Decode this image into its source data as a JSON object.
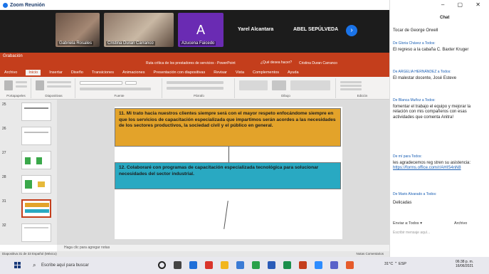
{
  "window": {
    "title": "Zoom Reunión"
  },
  "video": {
    "tiles": [
      {
        "name": "Gabriela Rosales"
      },
      {
        "name": "Cristina Duran Carranco"
      },
      {
        "name": "Azucena Faicedo",
        "initial": "A"
      }
    ],
    "labels": [
      "Yarel Alcantara",
      "ABEL SEPÚLVEDA"
    ],
    "next_glyph": "›"
  },
  "ppt": {
    "top_left": "Grabación",
    "doc_title": "Ruta crítica de los prestadores de servicios - PowerPoint",
    "search": "¿Qué desea hacer?",
    "user": "Cristina Duran Carranco",
    "tabs": [
      "Archivo",
      "Inicio",
      "Insertar",
      "Diseño",
      "Transiciones",
      "Animaciones",
      "Presentación con diapositivas",
      "Revisar",
      "Vista",
      "Complementos",
      "Ayuda"
    ],
    "ribbon_groups": [
      "Portapapeles",
      "Diapositivas",
      "Fuente",
      "Párrafo",
      "Dibujo",
      "Edición"
    ]
  },
  "thumbnails": [
    {
      "num": "25"
    },
    {
      "num": "26"
    },
    {
      "num": "27"
    },
    {
      "num": "28"
    },
    {
      "num": "31"
    },
    {
      "num": "32"
    }
  ],
  "slide": {
    "box1": "11. Mi trato hacia nuestros clientes siempre será con el mayor respeto enfocándome siempre en que los servicios de capacitación especializada que impartimos serán acordes a las necesidades de los sectores productivos, la sociedad civil y el público en general.",
    "box2": "12. Colaboraré con programas de capacitación especializada tecnológica para solucionar necesidades del sector industrial."
  },
  "notes": "Haga clic para agregar notas",
  "status": {
    "left": "Diapositiva 31 de 33   Español (México)",
    "right": "Notas   Comentarios"
  },
  "chat": {
    "title": "Chat",
    "messages": [
      {
        "from": "",
        "text": "Tocar de George Orwell"
      },
      {
        "from": "De Gloria Chávez a Todos:",
        "text": "El regreso a la cabaña C. Baxter Kruger"
      },
      {
        "from": "De ARGELIA HERNÁNDEZ a Todos:",
        "text": "El malestar docente, José Esteve"
      },
      {
        "from": "De Blanca Muñoz a Todos:",
        "text": "fomentar el trabajo el equipo y mejorar la relación con mis compañeros con esas actividades que comenta Anitra!"
      },
      {
        "from": "De mí para Todos:",
        "text": "les agradecemos reg stren su asistencia:",
        "link": "https://forms.office.com/r/AHIS4nN8"
      },
      {
        "from": "De Mario Alvarado a Todos:",
        "text": "Delicadas"
      }
    ],
    "to_label": "Enviar a:",
    "to_value": "Todos ▾",
    "file_label": "Archivo",
    "input_placeholder": "Escribir mensaje aquí..."
  },
  "taskbar": {
    "search_placeholder": "Escribe aquí para buscar",
    "tray": "31°C  ⌃  ESP",
    "time": "06:38 p. m.",
    "date": "16/06/2021"
  },
  "colors": {
    "ppt_accent": "#c43e1c",
    "box1_fill": "#e3a32a",
    "box2_fill": "#29a9c2",
    "zoom_blue": "#1a73e8",
    "purple_avatar": "#6a2bb3"
  }
}
